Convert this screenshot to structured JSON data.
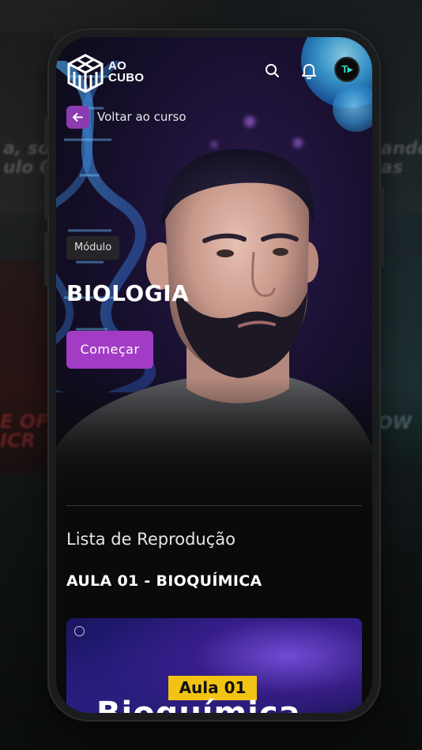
{
  "header": {
    "logo_line1": "AO",
    "logo_line2": "CUBO",
    "search_icon": "search-icon",
    "notifications_icon": "bell-icon",
    "avatar_initials": "T▸"
  },
  "back": {
    "icon": "arrow-left-icon",
    "label": "Voltar ao curso"
  },
  "module": {
    "tag": "Módulo",
    "title": "BIOLOGIA",
    "start_label": "Começar"
  },
  "playlist": {
    "heading": "Lista de Reprodução",
    "lesson_title": "AULA 01 - BIOQUÍMICA",
    "card": {
      "badge": "Aula 01",
      "big_text": "Bioquímica"
    }
  },
  "colors": {
    "accent": "#a23cc4",
    "back_button": "#8c3bb0",
    "badge": "#f3c313",
    "background": "#0a0a0a"
  }
}
